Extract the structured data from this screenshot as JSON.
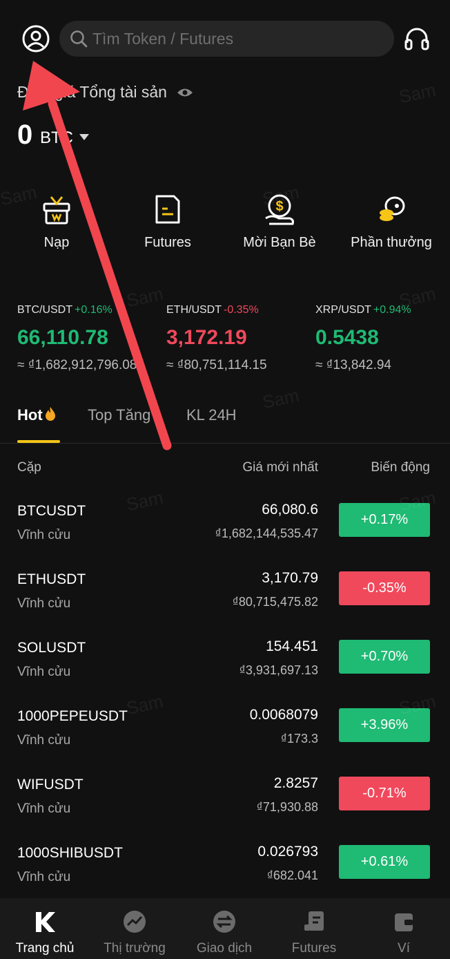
{
  "header": {
    "search_placeholder": "Tìm Token / Futures"
  },
  "assets": {
    "label": "Định giá Tổng tài sản",
    "value": "0",
    "unit": "BTC"
  },
  "quick_actions": [
    {
      "label": "Nạp",
      "icon": "gift-box-icon"
    },
    {
      "label": "Futures",
      "icon": "futures-doc-icon"
    },
    {
      "label": "Mời Bạn Bè",
      "icon": "invite-coin-icon"
    },
    {
      "label": "Phần thưởng",
      "icon": "reward-coins-icon"
    }
  ],
  "tickers": [
    {
      "pair": "BTC/USDT",
      "change": "+0.16%",
      "price": "66,110.78",
      "fiat": "≈ ₫1,682,912,796.085",
      "dir": "up"
    },
    {
      "pair": "ETH/USDT",
      "change": "-0.35%",
      "price": "3,172.19",
      "fiat": "≈ ₫80,751,114.15",
      "dir": "down"
    },
    {
      "pair": "XRP/USDT",
      "change": "+0.94%",
      "price": "0.5438",
      "fiat": "≈ ₫13,842.94",
      "dir": "up"
    }
  ],
  "tabs": [
    "Hot",
    "Top Tăng",
    "KL 24H"
  ],
  "columns": {
    "pair": "Cặp",
    "price": "Giá mới nhất",
    "change": "Biến động"
  },
  "markets": [
    {
      "symbol": "BTCUSDT",
      "kind": "Vĩnh cửu",
      "price": "66,080.6",
      "fiat": "₫1,682,144,535.47",
      "change": "+0.17%",
      "dir": "up"
    },
    {
      "symbol": "ETHUSDT",
      "kind": "Vĩnh cửu",
      "price": "3,170.79",
      "fiat": "₫80,715,475.82",
      "change": "-0.35%",
      "dir": "down"
    },
    {
      "symbol": "SOLUSDT",
      "kind": "Vĩnh cửu",
      "price": "154.451",
      "fiat": "₫3,931,697.13",
      "change": "+0.70%",
      "dir": "up"
    },
    {
      "symbol": "1000PEPEUSDT",
      "kind": "Vĩnh cửu",
      "price": "0.0068079",
      "fiat": "₫173.3",
      "change": "+3.96%",
      "dir": "up"
    },
    {
      "symbol": "WIFUSDT",
      "kind": "Vĩnh cửu",
      "price": "2.8257",
      "fiat": "₫71,930.88",
      "change": "-0.71%",
      "dir": "down"
    },
    {
      "symbol": "1000SHIBUSDT",
      "kind": "Vĩnh cửu",
      "price": "0.026793",
      "fiat": "₫682.041",
      "change": "+0.61%",
      "dir": "up"
    }
  ],
  "nav": [
    {
      "label": "Trang chủ",
      "icon": "home-k-icon",
      "active": true
    },
    {
      "label": "Thị trường",
      "icon": "market-chart-icon",
      "active": false
    },
    {
      "label": "Giao dịch",
      "icon": "trade-swap-icon",
      "active": false
    },
    {
      "label": "Futures",
      "icon": "futures-icon",
      "active": false
    },
    {
      "label": "Ví",
      "icon": "wallet-icon",
      "active": false
    }
  ],
  "watermark": "Sam",
  "colors": {
    "up": "#1fba74",
    "down": "#f0495c",
    "accent": "#f5c518",
    "arrow": "#f2464f"
  }
}
